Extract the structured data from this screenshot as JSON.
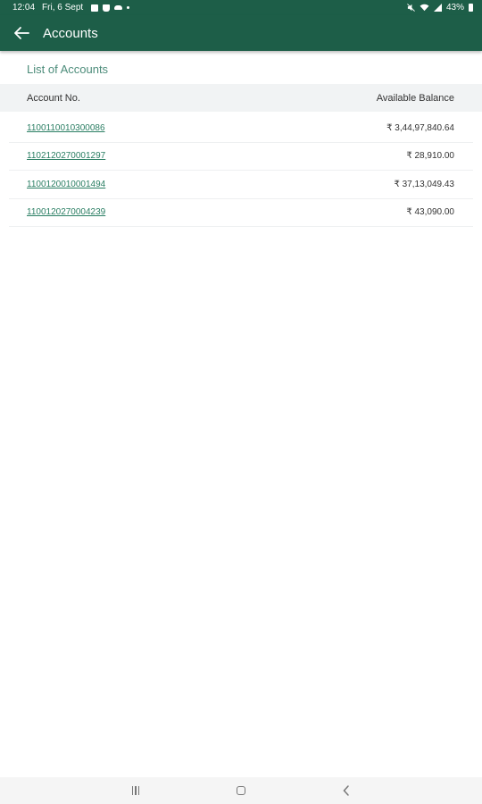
{
  "status_bar": {
    "time": "12:04",
    "date": "Fri, 6 Sept",
    "battery": "43%",
    "icons_left": [
      "photo-icon",
      "sim-icon",
      "cloud-icon",
      "dot-icon"
    ],
    "icons_right": [
      "mute-icon",
      "wifi-icon",
      "signal-icon",
      "battery-icon"
    ]
  },
  "app_bar": {
    "title": "Accounts",
    "back_icon": "arrow-left-icon"
  },
  "section": {
    "title": "List of Accounts"
  },
  "table": {
    "columns": [
      "Account No.",
      "Available Balance"
    ],
    "rows": [
      {
        "account": "1100110010300086",
        "balance": "₹ 3,44,97,840.64"
      },
      {
        "account": "1102120270001297",
        "balance": "₹ 28,910.00"
      },
      {
        "account": "1100120010001494",
        "balance": "₹ 37,13,049.43"
      },
      {
        "account": "1100120270004239",
        "balance": "₹ 43,090.00"
      }
    ]
  },
  "nav_bar": {
    "buttons": [
      "recents-icon",
      "home-icon",
      "back-icon"
    ]
  },
  "colors": {
    "primary": "#1d5e48",
    "link": "#2a7e63",
    "section_title": "#4c8c7a",
    "header_bg": "#f1f3f4"
  }
}
